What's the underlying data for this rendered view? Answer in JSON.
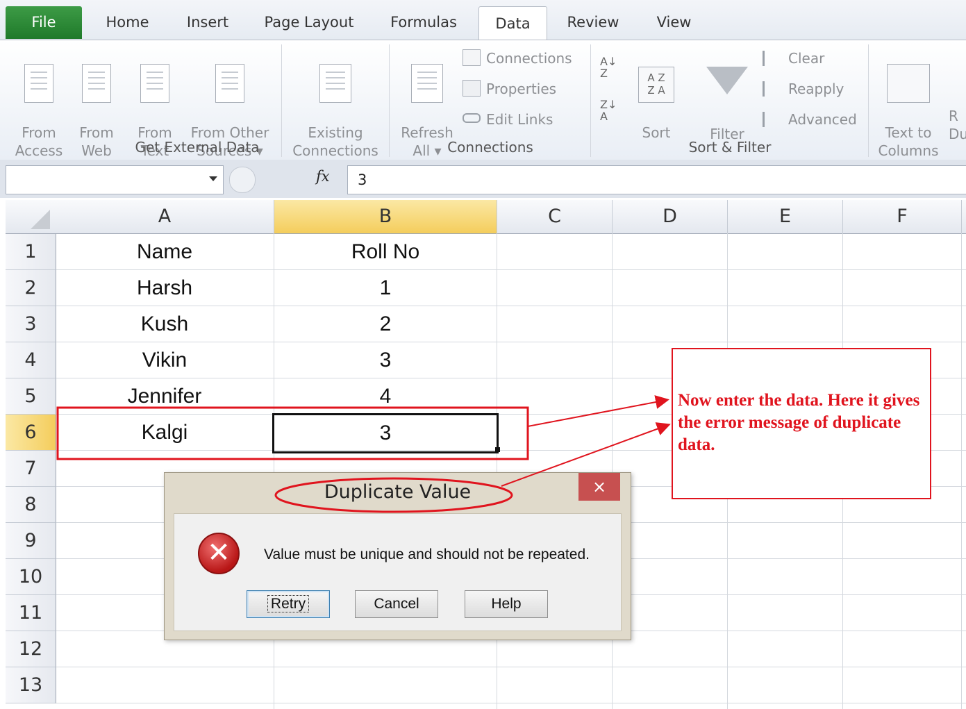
{
  "ribbon": {
    "tabs": [
      {
        "label": "File"
      },
      {
        "label": "Home"
      },
      {
        "label": "Insert"
      },
      {
        "label": "Page Layout"
      },
      {
        "label": "Formulas"
      },
      {
        "label": "Data"
      },
      {
        "label": "Review"
      },
      {
        "label": "View"
      }
    ],
    "active_tab": "Data",
    "groups": {
      "external_data": {
        "label": "Get External Data",
        "from_access": "From\nAccess",
        "from_web": "From\nWeb",
        "from_text": "From\nText",
        "from_other": "From Other\nSources ▾",
        "existing": "Existing\nConnections"
      },
      "connections": {
        "label": "Connections",
        "refresh": "Refresh\nAll ▾",
        "connections": "Connections",
        "properties": "Properties",
        "edit_links": "Edit Links"
      },
      "sort_filter": {
        "label": "Sort & Filter",
        "sort": "Sort",
        "filter": "Filter",
        "clear": "Clear",
        "reapply": "Reapply",
        "advanced": "Advanced"
      },
      "data_tools": {
        "text_to_columns": "Text to\nColumns",
        "next_partial": "R\nDu"
      }
    }
  },
  "formula_bar": {
    "name_box": "",
    "fx_symbol": "fx",
    "value": "3"
  },
  "sheet": {
    "columns": [
      "A",
      "B",
      "C",
      "D",
      "E",
      "F"
    ],
    "selected_column": "B",
    "rows": [
      "1",
      "2",
      "3",
      "4",
      "5",
      "6",
      "7",
      "8",
      "9",
      "10",
      "11",
      "12",
      "13"
    ],
    "selected_row": "6",
    "cells": {
      "a1": "Name",
      "b1": "Roll No",
      "a2": "Harsh",
      "b2": "1",
      "a3": "Kush",
      "b3": "2",
      "a4": "Vikin",
      "b4": "3",
      "a5": "Jennifer",
      "b5": "4",
      "a6": "Kalgi",
      "b6": "3"
    }
  },
  "dialog": {
    "title": "Duplicate Value",
    "close": "×",
    "message": "Value must be unique and should not be repeated.",
    "buttons": {
      "retry": "Retry",
      "cancel": "Cancel",
      "help": "Help"
    }
  },
  "annotation": {
    "text": "Now enter the data. Here it gives the error message of duplicate data.",
    "color": "#e0141e"
  }
}
